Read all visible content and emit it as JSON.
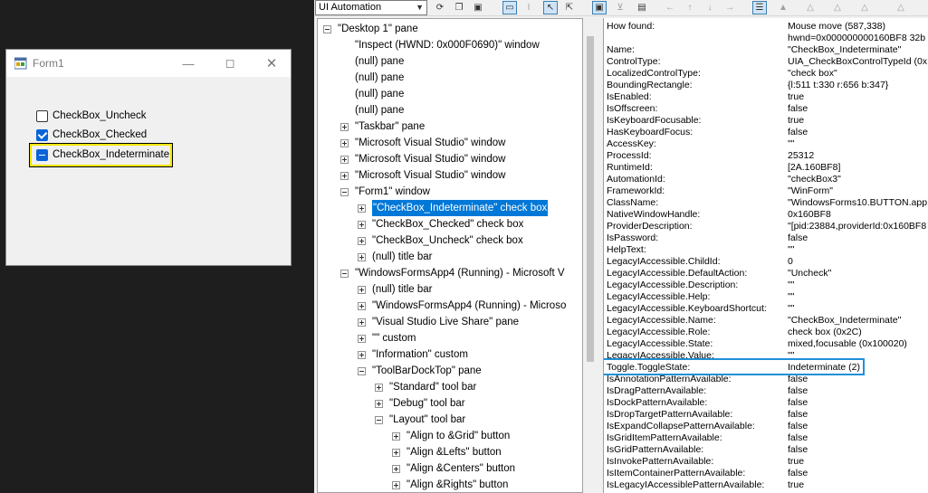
{
  "form1": {
    "title": "Form1",
    "checkboxes": [
      {
        "label": "CheckBox_Uncheck",
        "state": "unchecked"
      },
      {
        "label": "CheckBox_Checked",
        "state": "checked"
      },
      {
        "label": "CheckBox_Indeterminate",
        "state": "indeterminate"
      }
    ]
  },
  "inspect": {
    "mode": "UI Automation",
    "tree": [
      {
        "text": "\"Desktop 1\" pane",
        "exp": "minus"
      },
      {
        "text": "\"Inspect  (HWND: 0x000F0690)\" window",
        "exp": "none"
      },
      {
        "text": "(null) pane",
        "exp": "none"
      },
      {
        "text": "(null) pane",
        "exp": "none"
      },
      {
        "text": "(null) pane",
        "exp": "none"
      },
      {
        "text": "(null) pane",
        "exp": "none"
      },
      {
        "text": "\"Taskbar\" pane",
        "exp": "plus"
      },
      {
        "text": "\"Microsoft Visual Studio\" window",
        "exp": "plus"
      },
      {
        "text": "\"Microsoft Visual Studio\" window",
        "exp": "plus"
      },
      {
        "text": "\"Microsoft Visual Studio\" window",
        "exp": "plus"
      },
      {
        "text": "\"Form1\" window",
        "exp": "minus"
      },
      {
        "text": "\"CheckBox_Indeterminate\" check box",
        "exp": "plus",
        "selected": true
      },
      {
        "text": "\"CheckBox_Checked\" check box",
        "exp": "plus"
      },
      {
        "text": "\"CheckBox_Uncheck\" check box",
        "exp": "plus"
      },
      {
        "text": "(null) title bar",
        "exp": "plus"
      },
      {
        "text": "\"WindowsFormsApp4 (Running) - Microsoft V",
        "exp": "minus"
      },
      {
        "text": "(null) title bar",
        "exp": "plus"
      },
      {
        "text": "\"WindowsFormsApp4 (Running) - Microso",
        "exp": "plus"
      },
      {
        "text": "\"Visual Studio Live Share\" pane",
        "exp": "plus"
      },
      {
        "text": "\"\" custom",
        "exp": "plus"
      },
      {
        "text": "\"Information\" custom",
        "exp": "plus"
      },
      {
        "text": "\"ToolBarDockTop\" pane",
        "exp": "minus"
      },
      {
        "text": "\"Standard\" tool bar",
        "exp": "plus"
      },
      {
        "text": "\"Debug\" tool bar",
        "exp": "plus"
      },
      {
        "text": "\"Layout\" tool bar",
        "exp": "minus"
      },
      {
        "text": "\"Align to &Grid\" button",
        "exp": "plus"
      },
      {
        "text": "\"Align &Lefts\" button",
        "exp": "plus"
      },
      {
        "text": "\"Align &Centers\" button",
        "exp": "plus"
      },
      {
        "text": "\"Align &Rights\" button",
        "exp": "plus"
      }
    ],
    "properties": [
      {
        "name": "How found:",
        "value": "Mouse move (587,338)"
      },
      {
        "name": "",
        "value": "hwnd=0x000000000160BF8 32b"
      },
      {
        "name": "Name:",
        "value": "\"CheckBox_Indeterminate\""
      },
      {
        "name": "ControlType:",
        "value": "UIA_CheckBoxControlTypeId (0x"
      },
      {
        "name": "LocalizedControlType:",
        "value": "\"check box\""
      },
      {
        "name": "BoundingRectangle:",
        "value": "{l:511 t:330 r:656 b:347}"
      },
      {
        "name": "IsEnabled:",
        "value": "true"
      },
      {
        "name": "IsOffscreen:",
        "value": "false"
      },
      {
        "name": "IsKeyboardFocusable:",
        "value": "true"
      },
      {
        "name": "HasKeyboardFocus:",
        "value": "false"
      },
      {
        "name": "AccessKey:",
        "value": "\"\""
      },
      {
        "name": "ProcessId:",
        "value": "25312"
      },
      {
        "name": "RuntimeId:",
        "value": "[2A.160BF8]"
      },
      {
        "name": "AutomationId:",
        "value": "\"checkBox3\""
      },
      {
        "name": "FrameworkId:",
        "value": "\"WinForm\""
      },
      {
        "name": "ClassName:",
        "value": "\"WindowsForms10.BUTTON.app"
      },
      {
        "name": "NativeWindowHandle:",
        "value": "0x160BF8"
      },
      {
        "name": "ProviderDescription:",
        "value": "\"[pid:23884,providerId:0x160BF8"
      },
      {
        "name": "IsPassword:",
        "value": "false"
      },
      {
        "name": "HelpText:",
        "value": "\"\""
      },
      {
        "name": "LegacyIAccessible.ChildId:",
        "value": "0"
      },
      {
        "name": "LegacyIAccessible.DefaultAction:",
        "value": "\"Uncheck\""
      },
      {
        "name": "LegacyIAccessible.Description:",
        "value": "\"\""
      },
      {
        "name": "LegacyIAccessible.Help:",
        "value": "\"\""
      },
      {
        "name": "LegacyIAccessible.KeyboardShortcut:",
        "value": "\"\""
      },
      {
        "name": "LegacyIAccessible.Name:",
        "value": "\"CheckBox_Indeterminate\""
      },
      {
        "name": "LegacyIAccessible.Role:",
        "value": "check box (0x2C)"
      },
      {
        "name": "LegacyIAccessible.State:",
        "value": "mixed,focusable (0x100020)"
      },
      {
        "name": "LegacyIAccessible.Value:",
        "value": "\"\""
      },
      {
        "name": "Toggle.ToggleState:",
        "value": "Indeterminate (2)"
      },
      {
        "name": "IsAnnotationPatternAvailable:",
        "value": "false"
      },
      {
        "name": "IsDragPatternAvailable:",
        "value": "false"
      },
      {
        "name": "IsDockPatternAvailable:",
        "value": "false"
      },
      {
        "name": "IsDropTargetPatternAvailable:",
        "value": "false"
      },
      {
        "name": "IsExpandCollapsePatternAvailable:",
        "value": "false"
      },
      {
        "name": "IsGridItemPatternAvailable:",
        "value": "false"
      },
      {
        "name": "IsGridPatternAvailable:",
        "value": "false"
      },
      {
        "name": "IsInvokePatternAvailable:",
        "value": "true"
      },
      {
        "name": "IsItemContainerPatternAvailable:",
        "value": "false"
      },
      {
        "name": "IsLegacyIAccessiblePatternAvailable:",
        "value": "true"
      }
    ]
  }
}
